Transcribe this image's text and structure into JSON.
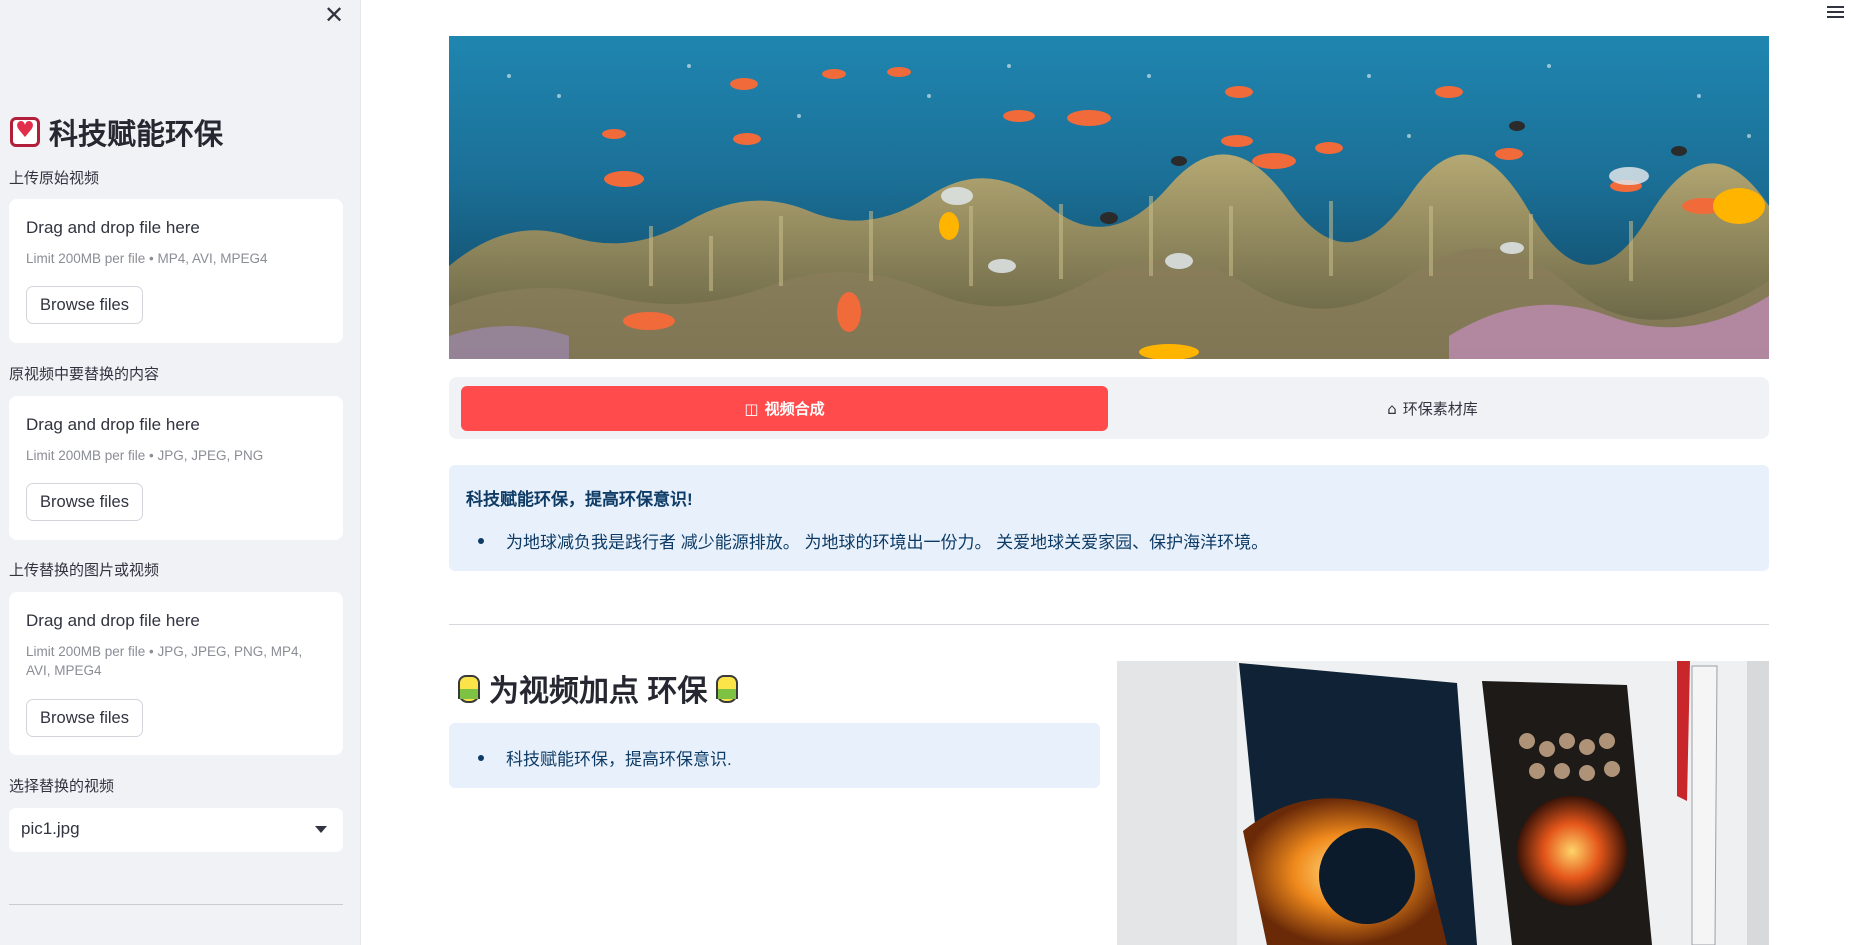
{
  "sidebar": {
    "title": "科技赋能环保",
    "title_icon": "heart-emoji-icon",
    "close_icon": "close-icon",
    "close_glyph": "✕",
    "upload_original": {
      "label": "上传原始视频",
      "drop_text": "Drag and drop file here",
      "limit": "Limit 200MB per file • MP4, AVI, MPEG4",
      "button": "Browse files"
    },
    "upload_replace_target": {
      "label": "原视频中要替换的内容",
      "drop_text": "Drag and drop file here",
      "limit": "Limit 200MB per file • JPG, JPEG, PNG",
      "button": "Browse files"
    },
    "upload_replacement": {
      "label": "上传替换的图片或视频",
      "drop_text": "Drag and drop file here",
      "limit": "Limit 200MB per file • JPG, JPEG, PNG, MP4, AVI, MPEG4",
      "button": "Browse files"
    },
    "select": {
      "label": "选择替换的视频",
      "value": "pic1.jpg"
    }
  },
  "main": {
    "tabs": [
      {
        "label": "视频合成",
        "icon": "columns-icon",
        "glyph": "◫",
        "active": true
      },
      {
        "label": "环保素材库",
        "icon": "home-icon",
        "glyph": "⌂",
        "active": false
      }
    ],
    "info_box": {
      "heading": "科技赋能环保，提高环保意识!",
      "bullet": "为地球减负我是践行者 减少能源排放。 为地球的环境出一份力。 关爱地球关爱家园、保护海洋环境。"
    },
    "section": {
      "title": "为视频加点 环保",
      "icon": "bucket-emoji-icon",
      "bullet": "科技赋能环保，提高环保意识."
    }
  },
  "colors": {
    "accent": "#ff4b4b",
    "sidebar_bg": "#f0f2f6",
    "info_bg": "#e8f1fb",
    "info_text": "#0d3b66"
  }
}
